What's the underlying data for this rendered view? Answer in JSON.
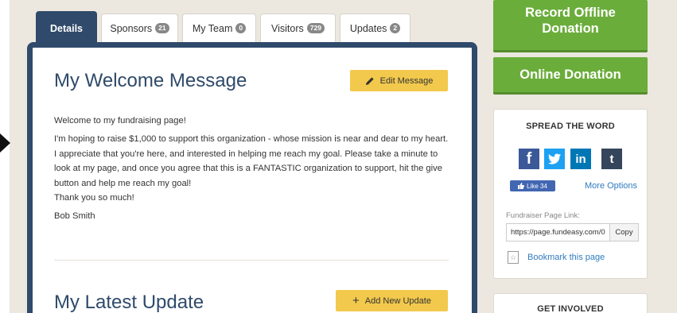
{
  "tabs": [
    {
      "label": "Details",
      "badge": ""
    },
    {
      "label": "Sponsors",
      "badge": "21"
    },
    {
      "label": "My Team",
      "badge": "0"
    },
    {
      "label": "Visitors",
      "badge": "729"
    },
    {
      "label": "Updates",
      "badge": "2"
    }
  ],
  "welcome": {
    "title": "My Welcome Message",
    "edit_label": "Edit Message",
    "paragraphs": [
      "Welcome to my fundraising page!",
      "I'm hoping to raise $1,000 to support this organization - whose mission is near and dear to my heart. I appreciate that you're here, and interested in helping me reach my goal. Please take a minute to look at my page, and once you agree that this is a FANTASTIC organization to support, hit the give button and help me reach my goal!",
      "Thank you so much!",
      "Bob Smith"
    ]
  },
  "update": {
    "title": "My Latest Update",
    "add_label": "Add New Update"
  },
  "sidebar": {
    "record_offline": "Record Offline Donation",
    "online_donation": "Online Donation",
    "spread": {
      "title": "SPREAD THE WORD",
      "social_icons": [
        "facebook-icon",
        "twitter-icon",
        "linkedin-icon",
        "tumblr-icon"
      ],
      "like_label": "Like 34",
      "more_options": "More Options",
      "page_link_label": "Fundraiser Page Link:",
      "page_link_value": "https://page.fundeasy.com/0",
      "copy_label": "Copy",
      "bookmark_label": "Bookmark this page"
    },
    "get_involved_title": "GET INVOLVED"
  },
  "colors": {
    "navy": "#2f4a6a",
    "green": "#6bad3b",
    "yellow": "#f2c94c",
    "facebook": "#3b5998",
    "twitter": "#1da1f2",
    "linkedin": "#0077b5",
    "tumblr": "#35465c"
  }
}
